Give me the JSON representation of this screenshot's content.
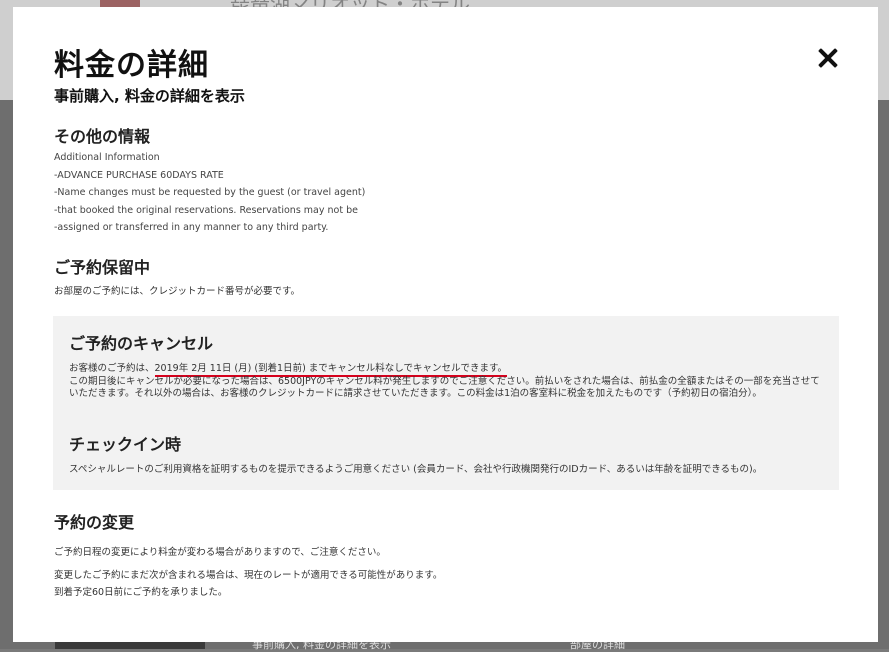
{
  "background": {
    "hotel_title": "琵琶湖マリオット・ホテル",
    "bottom_left": "事前購入, 料金の詳細を表示",
    "bottom_right": "部屋の詳細"
  },
  "modal": {
    "title": "料金の詳細",
    "subtitle": "事前購入, 料金の詳細を表示",
    "close_label": "×",
    "other_info": {
      "heading": "その他の情報",
      "lines": [
        "Additional Information",
        "-ADVANCE PURCHASE 60DAYS RATE",
        "-Name changes must be requested by the guest (or travel agent)",
        "-that booked the original reservations. Reservations may not be",
        "-assigned or transferred in any manner to any third party."
      ]
    },
    "hold": {
      "heading": "ご予約保留中",
      "text": "お部屋のご予約には、クレジットカード番号が必要です。"
    },
    "cancel": {
      "heading": "ご予約のキャンセル",
      "line1_prefix": "お客様のご予約は、",
      "line1_highlight": "2019年 2月 11日 (月) (到着1日前) までキャンセル料なしでキャンセルできます。",
      "paragraph": "この期日後にキャンセルが必要になった場合は、6500JPYのキャンセル料が発生しますのでご注意ください。前払いをされた場合は、前払金の全額またはその一部を充当させていただきます。それ以外の場合は、お客様のクレジットカードに請求させていただきます。この料金は1泊の客室料に税金を加えたものです（予約初日の宿泊分）。"
    },
    "checkin": {
      "heading": "チェックイン時",
      "text": "スペシャルレートのご利用資格を証明するものを提示できるようご用意ください (会員カード、会社や行政機関発行のIDカード、あるいは年齢を証明できるもの)。"
    },
    "change": {
      "heading": "予約の変更",
      "line1": "ご予約日程の変更により料金が変わる場合がありますので、ご注意ください。",
      "line2": "変更したご予約にまだ次が含まれる場合は、現在のレートが適用できる可能性があります。",
      "line3": "到着予定60日前にご予約を承りました。"
    }
  }
}
